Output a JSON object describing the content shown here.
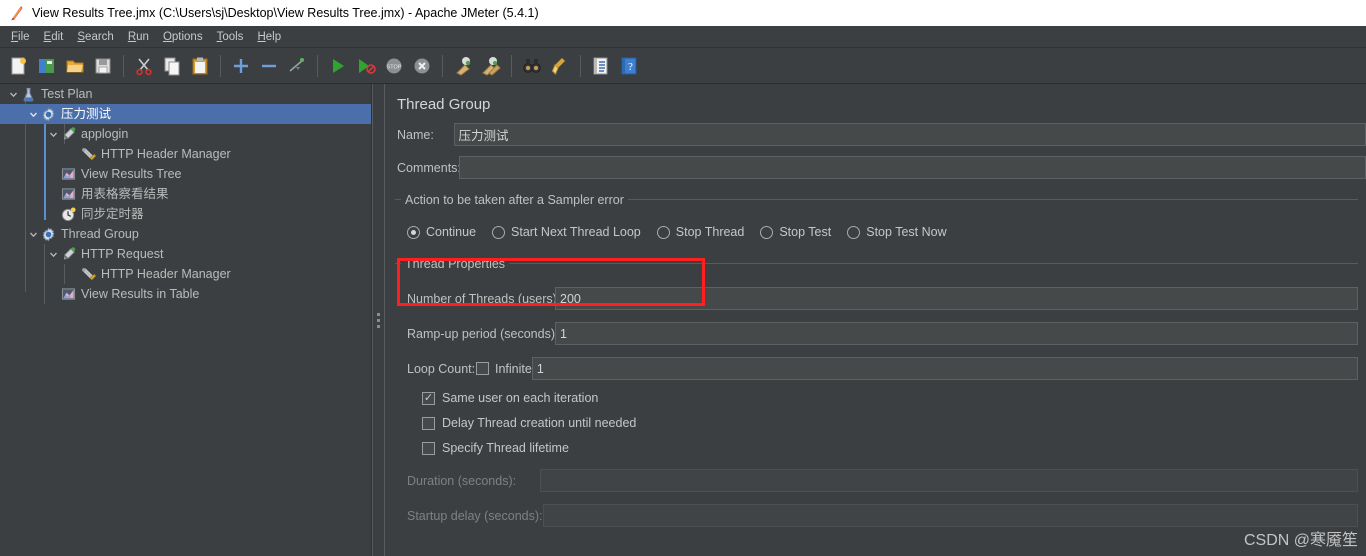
{
  "window": {
    "title": "View Results Tree.jmx (C:\\Users\\sj\\Desktop\\View Results Tree.jmx) - Apache JMeter (5.4.1)",
    "app_icon": "jmeter-feather-icon"
  },
  "menubar": {
    "items": [
      {
        "label": "File",
        "mnemonic": "F"
      },
      {
        "label": "Edit",
        "mnemonic": "E"
      },
      {
        "label": "Search",
        "mnemonic": "S"
      },
      {
        "label": "Run",
        "mnemonic": "R"
      },
      {
        "label": "Options",
        "mnemonic": "O"
      },
      {
        "label": "Tools",
        "mnemonic": "T"
      },
      {
        "label": "Help",
        "mnemonic": "H"
      }
    ]
  },
  "toolbar": {
    "buttons": [
      {
        "icon": "new-file-icon",
        "label": "New"
      },
      {
        "icon": "templates-icon",
        "label": "Templates"
      },
      {
        "icon": "open-folder-icon",
        "label": "Open"
      },
      {
        "icon": "save-icon",
        "label": "Save"
      },
      {
        "separator": true
      },
      {
        "icon": "cut-scissors-icon",
        "label": "Cut"
      },
      {
        "icon": "copy-icon",
        "label": "Copy"
      },
      {
        "icon": "paste-clipboard-icon",
        "label": "Paste"
      },
      {
        "separator": true
      },
      {
        "icon": "expand-plus-icon",
        "label": "Expand All"
      },
      {
        "icon": "collapse-minus-icon",
        "label": "Collapse All"
      },
      {
        "icon": "toggle-enable-icon",
        "label": "Toggle"
      },
      {
        "separator": true
      },
      {
        "icon": "start-play-icon",
        "label": "Start"
      },
      {
        "icon": "start-no-pauses-icon",
        "label": "Start no pauses"
      },
      {
        "icon": "stop-icon",
        "label": "Stop"
      },
      {
        "icon": "shutdown-icon",
        "label": "Shutdown"
      },
      {
        "separator": true
      },
      {
        "icon": "clear-broom-icon",
        "label": "Clear"
      },
      {
        "icon": "clear-all-broom-icon",
        "label": "Clear All"
      },
      {
        "separator": true
      },
      {
        "icon": "search-binoculars-icon",
        "label": "Search"
      },
      {
        "icon": "reset-search-brush-icon",
        "label": "Reset Search"
      },
      {
        "separator": true
      },
      {
        "icon": "function-helper-list-icon",
        "label": "Function Helper Dialog"
      },
      {
        "icon": "help-question-icon",
        "label": "Help"
      }
    ]
  },
  "tree": {
    "nodes": [
      {
        "label": "Test Plan",
        "icon": "test-plan-flask-icon",
        "depth": 0,
        "twist": "down",
        "selected": false
      },
      {
        "label": "压力测试",
        "icon": "thread-group-gear-icon",
        "depth": 1,
        "twist": "down",
        "selected": true
      },
      {
        "label": "applogin",
        "icon": "http-sampler-pipette-icon",
        "depth": 2,
        "twist": "down",
        "selected": false
      },
      {
        "label": "HTTP Header Manager",
        "icon": "header-manager-tools-icon",
        "depth": 3,
        "twist": "none",
        "selected": false
      },
      {
        "label": "View Results Tree",
        "icon": "listener-chart-icon",
        "depth": 2,
        "twist": "none",
        "selected": false
      },
      {
        "label": "用表格察看结果",
        "icon": "listener-chart-icon",
        "depth": 2,
        "twist": "none",
        "selected": false
      },
      {
        "label": "同步定时器",
        "icon": "timer-clock-icon",
        "depth": 2,
        "twist": "none",
        "selected": false
      },
      {
        "label": "Thread Group",
        "icon": "thread-group-gear-icon",
        "depth": 1,
        "twist": "down",
        "selected": false
      },
      {
        "label": "HTTP Request",
        "icon": "http-sampler-pipette-icon",
        "depth": 2,
        "twist": "down",
        "selected": false
      },
      {
        "label": "HTTP Header Manager",
        "icon": "header-manager-tools-icon",
        "depth": 3,
        "twist": "none",
        "selected": false
      },
      {
        "label": "View Results in Table",
        "icon": "listener-chart-icon",
        "depth": 2,
        "twist": "none",
        "selected": false
      }
    ]
  },
  "panel": {
    "title": "Thread Group",
    "name_label": "Name:",
    "name_value": "压力测试",
    "comments_label": "Comments:",
    "comments_value": "",
    "sampler_error": {
      "group_title": "Action to be taken after a Sampler error",
      "options": [
        {
          "label": "Continue",
          "selected": true
        },
        {
          "label": "Start Next Thread Loop",
          "selected": false
        },
        {
          "label": "Stop Thread",
          "selected": false
        },
        {
          "label": "Stop Test",
          "selected": false
        },
        {
          "label": "Stop Test Now",
          "selected": false
        }
      ]
    },
    "thread_properties": {
      "group_title": "Thread Properties",
      "threads_label": "Number of Threads (users):",
      "threads_value": "200",
      "rampup_label": "Ramp-up period (seconds):",
      "rampup_value": "1",
      "loop_label": "Loop Count:",
      "infinite_label": "Infinite",
      "infinite_checked": false,
      "loop_value": "1",
      "same_user_label": "Same user on each iteration",
      "same_user_checked": true,
      "delay_thread_label": "Delay Thread creation until needed",
      "delay_thread_checked": false,
      "specify_lifetime_label": "Specify Thread lifetime",
      "specify_lifetime_checked": false,
      "duration_label": "Duration (seconds):",
      "duration_value": "",
      "startup_delay_label": "Startup delay (seconds):",
      "startup_delay_value": ""
    }
  },
  "highlight": {
    "color": "#ff1f1f",
    "target": "number-of-threads-row"
  },
  "watermark": {
    "text": "CSDN @寒魇笙"
  },
  "colors": {
    "selection": "#4a6fab",
    "background": "#3c3f41",
    "field": "#45494a",
    "text": "#c0c0c0"
  }
}
